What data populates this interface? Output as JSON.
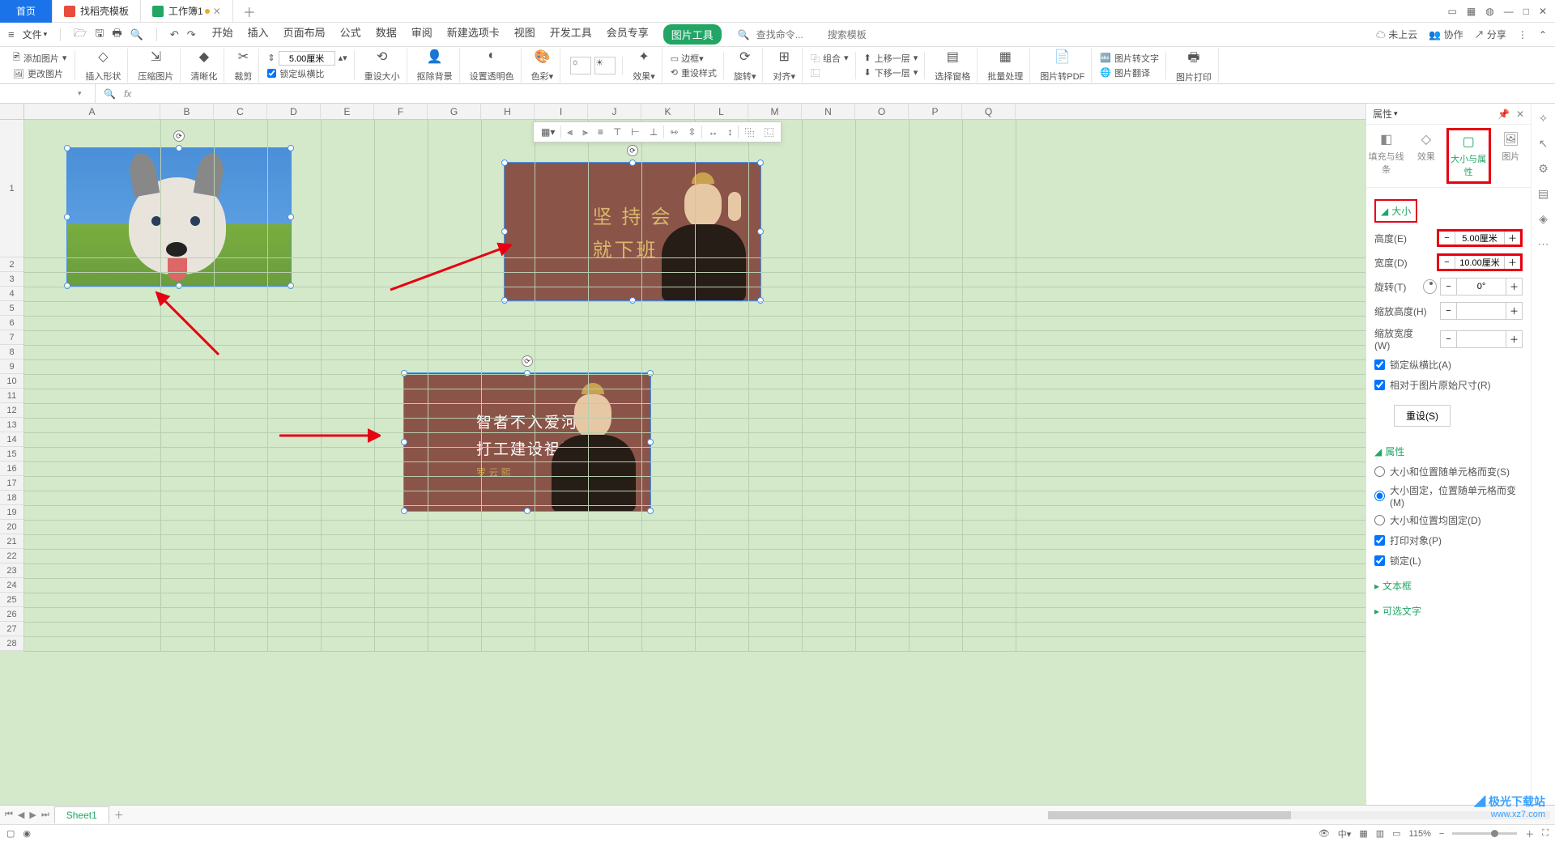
{
  "title_tabs": {
    "home": "首页",
    "t2": "找稻壳模板",
    "t3": "工作簿1"
  },
  "menu": {
    "file": "文件",
    "tabs": [
      "开始",
      "插入",
      "页面布局",
      "公式",
      "数据",
      "审阅",
      "新建选项卡",
      "视图",
      "开发工具",
      "会员专享",
      "图片工具"
    ],
    "active_idx": 10,
    "search_cmd": "查找命令...",
    "search_tpl": "搜索模板",
    "right": {
      "cloud": "未上云",
      "coop": "协作",
      "share": "分享"
    }
  },
  "ribbon": {
    "add_img": "添加图片",
    "change_img": "更改图片",
    "insert_shape": "插入形状",
    "compress": "压缩图片",
    "sharpen": "清晰化",
    "crop": "裁剪",
    "size_h": "5.00厘米",
    "lock_ratio": "锁定纵横比",
    "reset_size": "重设大小",
    "rm_bg": "抠除背景",
    "transparent": "设置透明色",
    "color": "色彩",
    "effect": "效果",
    "reset_style": "重设样式",
    "rotate": "旋转",
    "align": "对齐",
    "group": "组合",
    "up_layer": "上移一层",
    "down_layer": "下移一层",
    "sel_pane": "选择窗格",
    "batch": "批量处理",
    "to_pdf": "图片转PDF",
    "to_text": "图片转文字",
    "translate": "图片翻译",
    "print": "图片打印"
  },
  "panel": {
    "title": "属性",
    "tabs": {
      "fill": "填充与线条",
      "effect": "效果",
      "size": "大小与属性",
      "pic": "图片"
    },
    "sec_size": "大小",
    "height": "高度(E)",
    "height_v": "5.00厘米",
    "width": "宽度(D)",
    "width_v": "10.00厘米",
    "rotate": "旋转(T)",
    "rotate_v": "0°",
    "scale_h": "缩放高度(H)",
    "scale_w": "缩放宽度(W)",
    "lock": "锁定纵横比(A)",
    "rel": "相对于图片原始尺寸(R)",
    "reset": "重设(S)",
    "sec_prop": "属性",
    "r1": "大小和位置随单元格而变(S)",
    "r2": "大小固定，位置随单元格而变(M)",
    "r3": "大小和位置均固定(D)",
    "print": "打印对象(P)",
    "lock2": "锁定(L)",
    "sec_txt": "文本框",
    "sec_alt": "可选文字"
  },
  "sheet_tabs": {
    "s1": "Sheet1"
  },
  "status": {
    "zoom": "115%"
  },
  "cols": [
    "A",
    "B",
    "C",
    "D",
    "E",
    "F",
    "G",
    "H",
    "I",
    "J",
    "K",
    "L",
    "M",
    "N",
    "O",
    "P",
    "Q"
  ],
  "rows_tall": 1,
  "img2": {
    "l1": "坚 持         会",
    "l2": "就下班"
  },
  "img3": {
    "l1": "智者不入爱河",
    "l2": "打工建设祖国",
    "sig": "罗 云 熙"
  },
  "watermark": {
    "t1": "极光下载站",
    "t2": "www.xz7.com"
  }
}
